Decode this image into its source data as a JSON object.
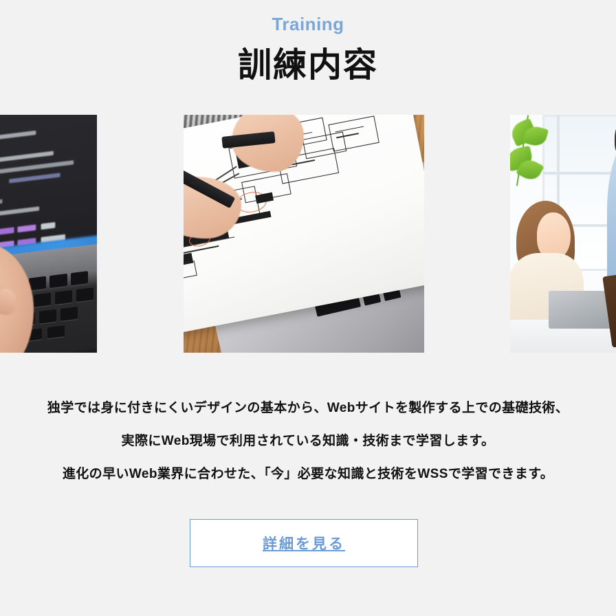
{
  "section": {
    "eyebrow": "Training",
    "headline": "訓練内容",
    "body_lines": [
      "独学では身に付きにくいデザインの基本から、Webサイトを製作する上での基礎技術、",
      "実際にWeb現場で利用されている知識・技術まで学習します。",
      "進化の早いWeb業界に合わせた、「今」必要な知識と技術をWSSで学習できます。"
    ],
    "cta_label": "詳細を見る"
  },
  "gallery": {
    "images": [
      {
        "alt": "code-editor-laptop-typing",
        "description": "ダークテーマのコードエディタとノートPCのキーボードに置かれた手"
      },
      {
        "alt": "wireframe-sketching-desk",
        "description": "木製デスクの上でワイヤーフレームを手書きスケッチする手とノートPC"
      },
      {
        "alt": "office-woman-laptop-meeting",
        "description": "明るいオフィスでノートPCに向かう女性と青いシャツの男性"
      }
    ]
  },
  "colors": {
    "background": "#f2f2f2",
    "eyebrow_blue": "#7ba7d7",
    "heading_black": "#111111",
    "cta_border": "#6c9bd2",
    "cta_text": "#6b9bd4",
    "cta_background": "#ffffff"
  }
}
